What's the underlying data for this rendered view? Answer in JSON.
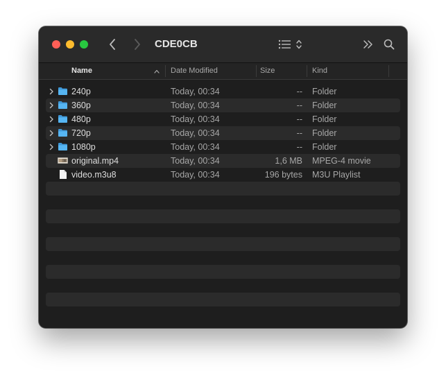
{
  "window": {
    "title": "CDE0CB"
  },
  "toolbar": {
    "back": "chevron-left",
    "forward": "chevron-right",
    "view": "list-view",
    "more": "chevron-double-right",
    "search": "search"
  },
  "columns": {
    "name": "Name",
    "date": "Date Modified",
    "size": "Size",
    "kind": "Kind"
  },
  "files": [
    {
      "name": "240p",
      "date": "Today, 00:34",
      "size": "--",
      "kind": "Folder",
      "icon": "folder-icon"
    },
    {
      "name": "360p",
      "date": "Today, 00:34",
      "size": "--",
      "kind": "Folder",
      "icon": "folder-icon"
    },
    {
      "name": "480p",
      "date": "Today, 00:34",
      "size": "--",
      "kind": "Folder",
      "icon": "folder-icon"
    },
    {
      "name": "720p",
      "date": "Today, 00:34",
      "size": "--",
      "kind": "Folder",
      "icon": "folder-icon"
    },
    {
      "name": "1080p",
      "date": "Today, 00:34",
      "size": "--",
      "kind": "Folder",
      "icon": "folder-icon"
    },
    {
      "name": "original.mp4",
      "date": "Today, 00:34",
      "size": "1,6 MB",
      "kind": "MPEG-4 movie",
      "icon": "video-thumbnail-icon"
    },
    {
      "name": "video.m3u8",
      "date": "Today, 00:34",
      "size": "196 bytes",
      "kind": "M3U Playlist",
      "icon": "document-icon"
    }
  ],
  "colors": {
    "folder": "#4fb0ee",
    "background": "#1e1e1e",
    "stripe": "#2b2b2b"
  }
}
